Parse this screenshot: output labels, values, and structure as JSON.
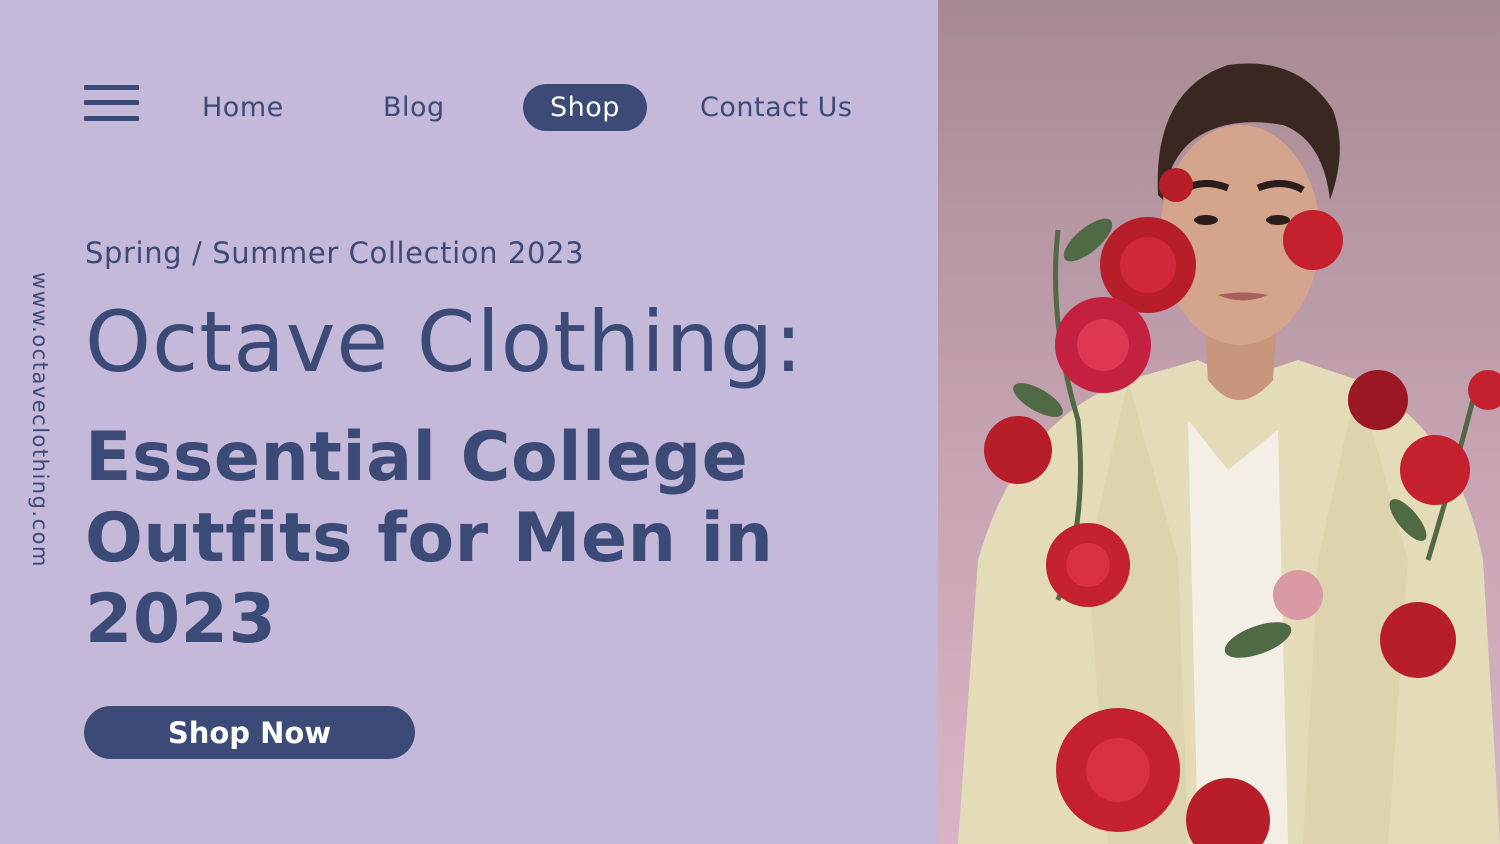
{
  "nav": {
    "home": "Home",
    "blog": "Blog",
    "shop": "Shop",
    "contact": "Contact Us"
  },
  "side_url": "www.octaveclothing.com",
  "hero": {
    "eyebrow": "Spring / Summer Collection 2023",
    "title": "Octave Clothing:",
    "subtitle": "Essential College Outfits for Men in 2023",
    "cta": "Shop Now"
  },
  "colors": {
    "background": "#c4b9d8",
    "accent": "#3c4a78",
    "button_text": "#ffffff"
  }
}
